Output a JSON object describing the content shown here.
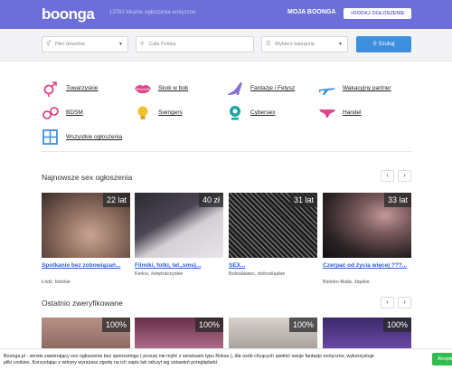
{
  "header": {
    "logo": "boonga",
    "tagline": "13782 lokalne ogłoszenia erotyczne",
    "account_label": "MOJA BOONGA",
    "add_button": "+DODAJ OGŁOSZENIE"
  },
  "search": {
    "gender_value": "Płeć dowolna",
    "location_placeholder": "Cała Polska",
    "category_value": "Wybierz kategorię",
    "submit_label": "Szukaj"
  },
  "categories": [
    {
      "label": "Towarzyskie",
      "icon": "gender-icon"
    },
    {
      "label": "Skok w bok",
      "icon": "lips-icon"
    },
    {
      "label": "Fantazje i Fetysz",
      "icon": "high-heel-icon"
    },
    {
      "label": "Wakacyjny partner",
      "icon": "airplane-icon"
    },
    {
      "label": "BDSM",
      "icon": "handcuffs-icon"
    },
    {
      "label": "Swingers",
      "icon": "lightbulb-icon"
    },
    {
      "label": "Cybersex",
      "icon": "webcam-icon"
    },
    {
      "label": "Handel",
      "icon": "underwear-icon"
    },
    {
      "label": "Wszystkie ogłoszenia",
      "icon": "grid-icon"
    }
  ],
  "newest": {
    "title": "Najnowsze sex ogłoszenia",
    "prev": "‹",
    "next": "›",
    "items": [
      {
        "badge": "22 lat",
        "title": "Spotkanie bez zobowiązań...",
        "location": "Łódź, łódzkie"
      },
      {
        "badge": "40 zł",
        "title": "Filmiki, fotki, tel.,sms)...",
        "location": "Kielce, świętokrzyskie"
      },
      {
        "badge": "31 lat",
        "title": "SEX...",
        "location": "Bolesławiec, dolnośląskie"
      },
      {
        "badge": "33 lat",
        "title": "Czerpać od życia więcej ???...",
        "location": "Bielsko-Biała, śląskie"
      }
    ]
  },
  "verified": {
    "title": "Ostatnio zweryfikowane",
    "prev": "‹",
    "next": "›",
    "items": [
      {
        "badge": "100%"
      },
      {
        "badge": "100%"
      },
      {
        "badge": "100%"
      },
      {
        "badge": "100%"
      }
    ]
  },
  "cookie": {
    "text": "Boonga.pl - serwis zawierający sex ogłoszenia bez sponsoringu ( proszę nie mylić z serwisami typu Roksa ), dla osób chcących spełnić swoje fantazje erotyczne, wykorzystuje pliki cookies. Korzystając z witryny wyrażasz zgodę na ich zapis lub odczyt wg ustawień przeglądarki.",
    "accept": "Akceptuję"
  },
  "colors": {
    "brand": "#6c6fd8",
    "search_button": "#3d8fe0",
    "link": "#2e63c2",
    "category_icon_pink": "#e0468a",
    "category_icon_teal": "#1ea3a3",
    "accept_green": "#2fbf4f"
  }
}
